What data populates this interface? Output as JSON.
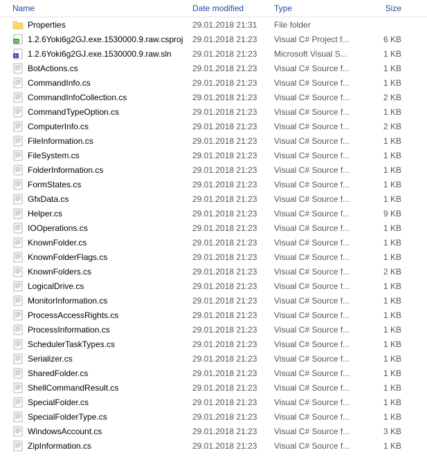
{
  "columns": {
    "name": "Name",
    "date": "Date modified",
    "type": "Type",
    "size": "Size"
  },
  "files": [
    {
      "icon": "folder",
      "name": "Properties",
      "date": "29.01.2018 21:31",
      "type": "File folder",
      "size": ""
    },
    {
      "icon": "csproj",
      "name": "1.2.6Yoki6g2GJ.exe.1530000.9.raw.csproj",
      "date": "29.01.2018 21:23",
      "type": "Visual C# Project f...",
      "size": "6 KB"
    },
    {
      "icon": "sln",
      "name": "1.2.6Yoki6g2GJ.exe.1530000.9.raw.sln",
      "date": "29.01.2018 21:23",
      "type": "Microsoft Visual S...",
      "size": "1 KB"
    },
    {
      "icon": "cs",
      "name": "BotActions.cs",
      "date": "29.01.2018 21:23",
      "type": "Visual C# Source f...",
      "size": "1 KB"
    },
    {
      "icon": "cs",
      "name": "CommandInfo.cs",
      "date": "29.01.2018 21:23",
      "type": "Visual C# Source f...",
      "size": "1 KB"
    },
    {
      "icon": "cs",
      "name": "CommandInfoCollection.cs",
      "date": "29.01.2018 21:23",
      "type": "Visual C# Source f...",
      "size": "2 KB"
    },
    {
      "icon": "cs",
      "name": "CommandTypeOption.cs",
      "date": "29.01.2018 21:23",
      "type": "Visual C# Source f...",
      "size": "1 KB"
    },
    {
      "icon": "cs",
      "name": "ComputerInfo.cs",
      "date": "29.01.2018 21:23",
      "type": "Visual C# Source f...",
      "size": "2 KB"
    },
    {
      "icon": "cs",
      "name": "FileInformation.cs",
      "date": "29.01.2018 21:23",
      "type": "Visual C# Source f...",
      "size": "1 KB"
    },
    {
      "icon": "cs",
      "name": "FileSystem.cs",
      "date": "29.01.2018 21:23",
      "type": "Visual C# Source f...",
      "size": "1 KB"
    },
    {
      "icon": "cs",
      "name": "FolderInformation.cs",
      "date": "29.01.2018 21:23",
      "type": "Visual C# Source f...",
      "size": "1 KB"
    },
    {
      "icon": "cs",
      "name": "FormStates.cs",
      "date": "29.01.2018 21:23",
      "type": "Visual C# Source f...",
      "size": "1 KB"
    },
    {
      "icon": "cs",
      "name": "GfxData.cs",
      "date": "29.01.2018 21:23",
      "type": "Visual C# Source f...",
      "size": "1 KB"
    },
    {
      "icon": "cs",
      "name": "Helper.cs",
      "date": "29.01.2018 21:23",
      "type": "Visual C# Source f...",
      "size": "9 KB"
    },
    {
      "icon": "cs",
      "name": "IOOperations.cs",
      "date": "29.01.2018 21:23",
      "type": "Visual C# Source f...",
      "size": "1 KB"
    },
    {
      "icon": "cs",
      "name": "KnownFolder.cs",
      "date": "29.01.2018 21:23",
      "type": "Visual C# Source f...",
      "size": "1 KB"
    },
    {
      "icon": "cs",
      "name": "KnownFolderFlags.cs",
      "date": "29.01.2018 21:23",
      "type": "Visual C# Source f...",
      "size": "1 KB"
    },
    {
      "icon": "cs",
      "name": "KnownFolders.cs",
      "date": "29.01.2018 21:23",
      "type": "Visual C# Source f...",
      "size": "2 KB"
    },
    {
      "icon": "cs",
      "name": "LogicalDrive.cs",
      "date": "29.01.2018 21:23",
      "type": "Visual C# Source f...",
      "size": "1 KB"
    },
    {
      "icon": "cs",
      "name": "MonitorInformation.cs",
      "date": "29.01.2018 21:23",
      "type": "Visual C# Source f...",
      "size": "1 KB"
    },
    {
      "icon": "cs",
      "name": "ProcessAccessRights.cs",
      "date": "29.01.2018 21:23",
      "type": "Visual C# Source f...",
      "size": "1 KB"
    },
    {
      "icon": "cs",
      "name": "ProcessInformation.cs",
      "date": "29.01.2018 21:23",
      "type": "Visual C# Source f...",
      "size": "1 KB"
    },
    {
      "icon": "cs",
      "name": "SchedulerTaskTypes.cs",
      "date": "29.01.2018 21:23",
      "type": "Visual C# Source f...",
      "size": "1 KB"
    },
    {
      "icon": "cs",
      "name": "Serializer.cs",
      "date": "29.01.2018 21:23",
      "type": "Visual C# Source f...",
      "size": "1 KB"
    },
    {
      "icon": "cs",
      "name": "SharedFolder.cs",
      "date": "29.01.2018 21:23",
      "type": "Visual C# Source f...",
      "size": "1 KB"
    },
    {
      "icon": "cs",
      "name": "ShellCommandResult.cs",
      "date": "29.01.2018 21:23",
      "type": "Visual C# Source f...",
      "size": "1 KB"
    },
    {
      "icon": "cs",
      "name": "SpecialFolder.cs",
      "date": "29.01.2018 21:23",
      "type": "Visual C# Source f...",
      "size": "1 KB"
    },
    {
      "icon": "cs",
      "name": "SpecialFolderType.cs",
      "date": "29.01.2018 21:23",
      "type": "Visual C# Source f...",
      "size": "1 KB"
    },
    {
      "icon": "cs",
      "name": "WindowsAccount.cs",
      "date": "29.01.2018 21:23",
      "type": "Visual C# Source f...",
      "size": "3 KB"
    },
    {
      "icon": "cs",
      "name": "ZipInformation.cs",
      "date": "29.01.2018 21:23",
      "type": "Visual C# Source f...",
      "size": "1 KB"
    }
  ]
}
